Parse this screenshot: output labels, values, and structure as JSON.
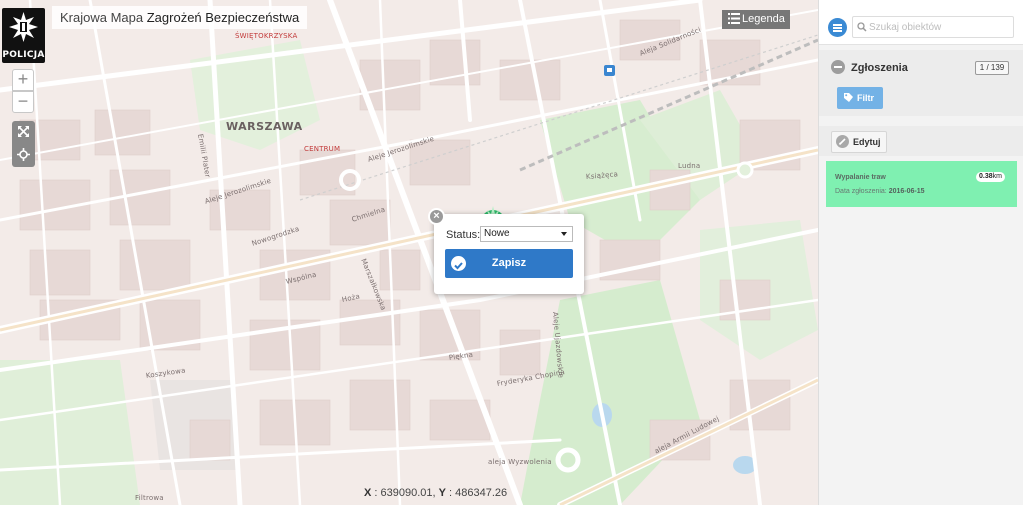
{
  "header": {
    "logo_text": "POLICJA",
    "title_prefix": "Krajowa Mapa",
    "title_bold": "Zagrożeń Bezpieczeństwa"
  },
  "map": {
    "legend_label": "Legenda",
    "zoom_in": "+",
    "zoom_out": "−",
    "labels": {
      "swietokrzyska": "ŚWIĘTOKRZYSKA",
      "warszawa": "WARSZAWA",
      "centrum": "CENTRUM",
      "jerozolimskie": "Aleje Jerozolimskie",
      "jerozolimskie2": "Aleje Jerozolimskie",
      "marszalkowska": "Marszałkowska",
      "koszykowa": "Koszykowa",
      "nowogrodzka": "Nowogrodzka",
      "hoza": "Hoża",
      "wspolna": "Wspólna",
      "piekna": "Piękna",
      "chopina": "Fryderyka Chopina",
      "ujazdowskie": "Aleje Ujazdowskie",
      "wyzwolenia": "aleja Wyzwolenia",
      "armii": "aleja Armii Ludowej",
      "chmielna": "Chmielna",
      "ksiazeca": "Książęca",
      "ludna": "Ludna",
      "solidarnosci": "Aleja Solidarności",
      "filtrowa": "Filtrowa",
      "emilii": "Emilii Plater"
    },
    "coords_x_label": "X",
    "coords_x": "639090.01",
    "coords_y_label": "Y",
    "coords_y": "486347.26"
  },
  "popup": {
    "status_label": "Status:",
    "status_value": "Nowe",
    "save_label": "Zapisz"
  },
  "sidebar": {
    "search_placeholder": "Szukaj obiektów",
    "section_title": "Zgłoszenia",
    "count": "1 / 139",
    "filter_label": "Filtr",
    "edit_label": "Edytuj",
    "report": {
      "title": "Wypalanie traw",
      "distance": "0.38",
      "distance_unit": "km",
      "date_label": "Data zgłoszenia:",
      "date": "2016-06-15"
    }
  },
  "colors": {
    "accent_blue": "#2f79c8",
    "report_green": "#7ff0b1",
    "filter_blue": "#73b2e6"
  }
}
